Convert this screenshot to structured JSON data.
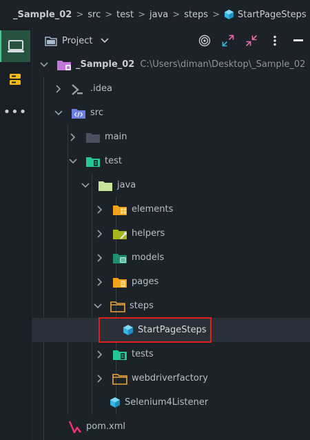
{
  "breadcrumb": {
    "project": "_Sample_02",
    "items": [
      "src",
      "test",
      "java",
      "steps"
    ],
    "current": "StartPageSteps",
    "separator": ">"
  },
  "activity_bar": {
    "items": [
      {
        "icon": "monitor-icon",
        "active": true
      },
      {
        "icon": "database-icon",
        "active": false
      },
      {
        "icon": "more-icon",
        "label": "•••"
      }
    ]
  },
  "panel": {
    "title": "Project",
    "tools": [
      "target-icon",
      "expand-icon",
      "collapse-icon",
      "more-vertical-icon",
      "minimize-icon"
    ]
  },
  "tree": [
    {
      "label": "_Sample_02",
      "path": "C:\\Users\\diman\\Desktop\\_Sample_02",
      "icon": "module-folder-icon",
      "expanded": true,
      "depth": 0
    },
    {
      "label": ".idea",
      "icon": "idea-folder-icon",
      "expanded": false,
      "depth": 1
    },
    {
      "label": "src",
      "icon": "source-folder-icon",
      "expanded": true,
      "depth": 1
    },
    {
      "label": "main",
      "icon": "folder-icon",
      "expanded": false,
      "depth": 2
    },
    {
      "label": "test",
      "icon": "test-folder-icon",
      "expanded": true,
      "depth": 2
    },
    {
      "label": "java",
      "icon": "java-folder-icon",
      "expanded": true,
      "depth": 3
    },
    {
      "label": "elements",
      "icon": "elements-folder-icon",
      "expanded": false,
      "depth": 4
    },
    {
      "label": "helpers",
      "icon": "helpers-folder-icon",
      "expanded": false,
      "depth": 4
    },
    {
      "label": "models",
      "icon": "models-folder-icon",
      "expanded": false,
      "depth": 4
    },
    {
      "label": "pages",
      "icon": "pages-folder-icon",
      "expanded": false,
      "depth": 4
    },
    {
      "label": "steps",
      "icon": "steps-folder-icon",
      "expanded": true,
      "depth": 4
    },
    {
      "label": "StartPageSteps",
      "icon": "java-class-icon",
      "selected": true,
      "depth": 5
    },
    {
      "label": "tests",
      "icon": "tests-folder-icon",
      "expanded": false,
      "depth": 4
    },
    {
      "label": "webdriverfactory",
      "icon": "folder-icon",
      "expanded": false,
      "depth": 4
    },
    {
      "label": "Selenium4Listener",
      "icon": "java-class-icon",
      "depth": 4
    },
    {
      "label": "pom.xml",
      "icon": "maven-icon",
      "depth": 1
    }
  ],
  "colors": {
    "background": "#1d2128",
    "accent": "#3ecf8e",
    "selection": "#2a2f38",
    "highlight_border": "#e0201c",
    "class_icon": "#35b8e6"
  }
}
